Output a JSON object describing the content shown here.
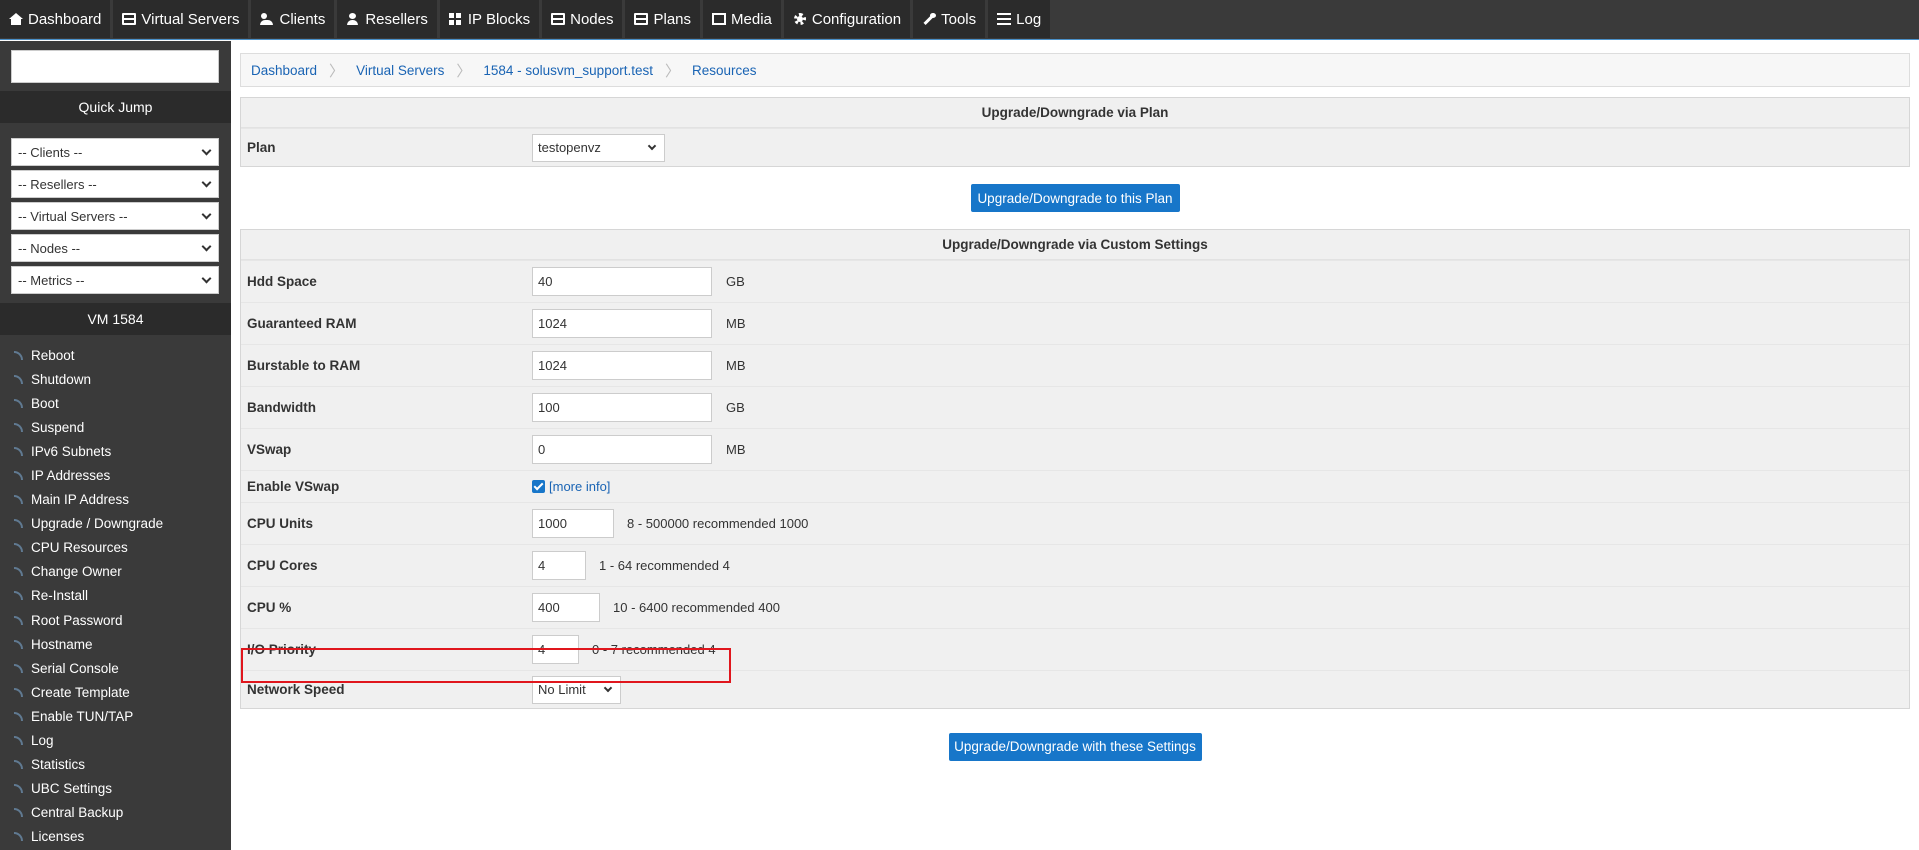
{
  "topnav": {
    "items": [
      {
        "label": "Dashboard",
        "icon": "home-icon"
      },
      {
        "label": "Virtual Servers",
        "icon": "server-icon"
      },
      {
        "label": "Clients",
        "icon": "users-icon"
      },
      {
        "label": "Resellers",
        "icon": "user-icon"
      },
      {
        "label": "IP Blocks",
        "icon": "grid-icon"
      },
      {
        "label": "Nodes",
        "icon": "server-icon"
      },
      {
        "label": "Plans",
        "icon": "server-icon"
      },
      {
        "label": "Media",
        "icon": "file-icon"
      },
      {
        "label": "Configuration",
        "icon": "gear-icon"
      },
      {
        "label": "Tools",
        "icon": "wrench-icon"
      },
      {
        "label": "Log",
        "icon": "list-icon"
      }
    ]
  },
  "sidebar": {
    "search_value": "",
    "quick_jump_title": "Quick Jump",
    "selects": [
      "-- Clients --",
      "-- Resellers --",
      "-- Virtual Servers --",
      "-- Nodes --",
      "-- Metrics --"
    ],
    "vm_title": "VM 1584",
    "links": [
      "Reboot",
      "Shutdown",
      "Boot",
      "Suspend",
      "IPv6 Subnets",
      "IP Addresses",
      "Main IP Address",
      "Upgrade / Downgrade",
      "CPU Resources",
      "Change Owner",
      "Re-Install",
      "Root Password",
      "Hostname",
      "Serial Console",
      "Create Template",
      "Enable TUN/TAP",
      "Log",
      "Statistics",
      "UBC Settings",
      "Central Backup",
      "Licenses"
    ]
  },
  "breadcrumb": [
    "Dashboard",
    "Virtual Servers",
    "1584 - solusvm_support.test",
    "Resources"
  ],
  "plan_panel": {
    "title": "Upgrade/Downgrade via Plan",
    "plan_label": "Plan",
    "plan_value": "testopenvz",
    "button": "Upgrade/Downgrade to this Plan"
  },
  "custom_panel": {
    "title": "Upgrade/Downgrade via Custom Settings",
    "hdd_label": "Hdd Space",
    "hdd_value": "40",
    "hdd_unit": "GB",
    "ram_label": "Guaranteed RAM",
    "ram_value": "1024",
    "ram_unit": "MB",
    "burst_label": "Burstable to RAM",
    "burst_value": "1024",
    "burst_unit": "MB",
    "bw_label": "Bandwidth",
    "bw_value": "100",
    "bw_unit": "GB",
    "vswap_label": "VSwap",
    "vswap_value": "0",
    "vswap_unit": "MB",
    "enable_vswap_label": "Enable VSwap",
    "enable_vswap_checked": true,
    "more_info": "[more info]",
    "cpu_units_label": "CPU Units",
    "cpu_units_value": "1000",
    "cpu_units_hint": "8 - 500000 recommended 1000",
    "cpu_cores_label": "CPU Cores",
    "cpu_cores_value": "4",
    "cpu_cores_hint": "1 - 64 recommended 4",
    "cpu_pct_label": "CPU %",
    "cpu_pct_value": "400",
    "cpu_pct_hint": "10 - 6400 recommended 400",
    "io_label": "I/O Priority",
    "io_value": "4",
    "io_hint": "0 - 7 recommended 4",
    "net_label": "Network Speed",
    "net_value": "No Limit",
    "button": "Upgrade/Downgrade with these Settings"
  },
  "colors": {
    "accent": "#1776c9",
    "highlight": "#e0161d",
    "nav_bg": "#2b2b2b"
  }
}
